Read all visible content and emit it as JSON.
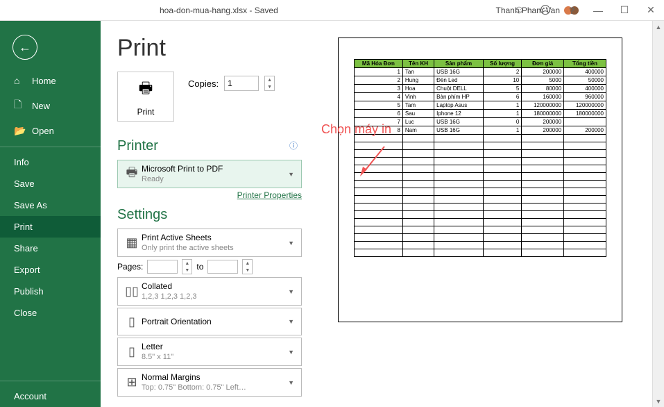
{
  "titlebar": {
    "doc_title": "hoa-don-mua-hang.xlsx - Saved",
    "user_name": "Thanh Pham Van"
  },
  "sidebar": {
    "home": "Home",
    "new": "New",
    "open": "Open",
    "info": "Info",
    "save": "Save",
    "save_as": "Save As",
    "print": "Print",
    "share": "Share",
    "export": "Export",
    "publish": "Publish",
    "close": "Close",
    "account": "Account"
  },
  "print": {
    "title": "Print",
    "button_label": "Print",
    "copies_label": "Copies:",
    "copies_value": "1"
  },
  "printer": {
    "section": "Printer",
    "name": "Microsoft Print to PDF",
    "status": "Ready",
    "properties_link": "Printer Properties"
  },
  "settings": {
    "section": "Settings",
    "active_sheets": "Print Active Sheets",
    "active_sheets_sub": "Only print the active sheets",
    "pages_label": "Pages:",
    "pages_to": "to",
    "collated": "Collated",
    "collated_sub": "1,2,3    1,2,3    1,2,3",
    "orientation": "Portrait Orientation",
    "letter": "Letter",
    "letter_sub": "8.5\" x 11\"",
    "margins": "Normal Margins",
    "margins_sub": "Top: 0.75\" Bottom: 0.75\" Left…"
  },
  "annotation_text": "Chọn máy in",
  "preview": {
    "headers": [
      "Mã Hóa Đơn",
      "Tên KH",
      "Sản phẩm",
      "Số lượng",
      "Đơn giá",
      "Tổng tiền"
    ],
    "rows": [
      [
        "1",
        "Tan",
        "USB 16G",
        "2",
        "200000",
        "400000"
      ],
      [
        "2",
        "Hung",
        "Đèn Led",
        "10",
        "5000",
        "50000"
      ],
      [
        "3",
        "Hoa",
        "Chuột DELL",
        "5",
        "80000",
        "400000"
      ],
      [
        "4",
        "Vinh",
        "Bàn phím HP",
        "6",
        "160000",
        "960000"
      ],
      [
        "5",
        "Tam",
        "Laptop Asus",
        "1",
        "120000000",
        "120000000"
      ],
      [
        "6",
        "Sau",
        "Iphone 12",
        "1",
        "180000000",
        "180000000"
      ],
      [
        "7",
        "Luc",
        "USB 16G",
        "0",
        "200000",
        ""
      ],
      [
        "8",
        "Nam",
        "USB 16G",
        "1",
        "200000",
        "200000"
      ]
    ],
    "empty_rows": 16
  }
}
